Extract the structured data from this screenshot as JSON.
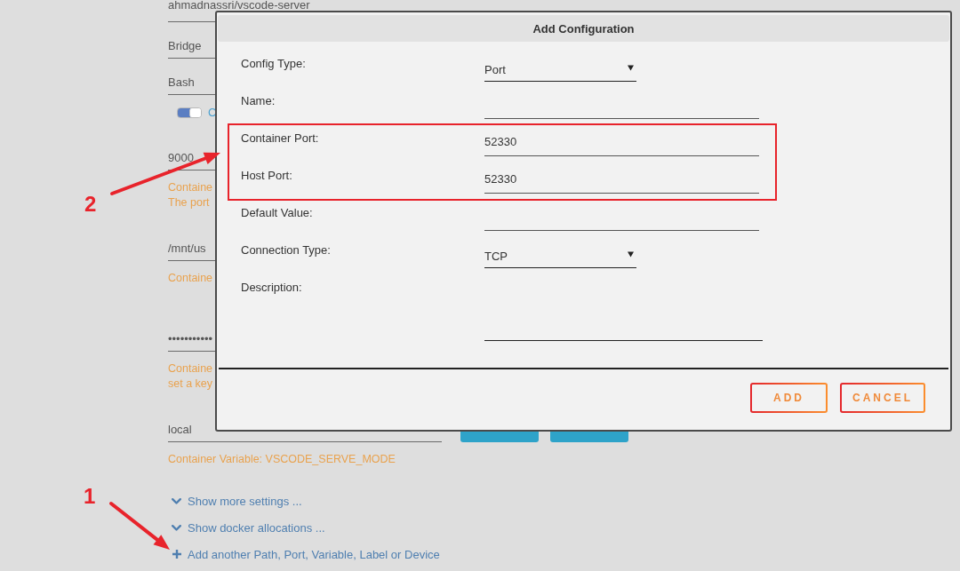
{
  "background_form": {
    "rows": [
      {
        "kind": "field",
        "value": "ahmadnassri/vscode-server"
      },
      {
        "kind": "field",
        "value": "Bridge"
      },
      {
        "kind": "field",
        "value": "Bash"
      },
      {
        "kind": "toggle",
        "on": true,
        "label": "C"
      },
      {
        "kind": "field",
        "value": "9000"
      },
      {
        "kind": "hint",
        "lines": [
          "Containe",
          "The port"
        ]
      },
      {
        "kind": "field",
        "value": "/mnt/us"
      },
      {
        "kind": "hint",
        "lines": [
          "Containe"
        ]
      },
      {
        "kind": "field",
        "value": "•••••••••••"
      },
      {
        "kind": "hint",
        "lines": [
          "Containe",
          "set a key"
        ]
      },
      {
        "kind": "field",
        "value": "local"
      },
      {
        "kind": "hint",
        "lines": [
          "Container Variable: VSCODE_SERVE_MODE"
        ]
      }
    ],
    "links": [
      {
        "kind": "expand",
        "label": "Show more settings ..."
      },
      {
        "kind": "expand",
        "label": "Show docker allocations ..."
      },
      {
        "kind": "add",
        "label": "Add another Path, Port, Variable, Label or Device"
      }
    ]
  },
  "dialog": {
    "title": "Add Configuration",
    "fields": [
      {
        "kind": "select",
        "label": "Config Type:",
        "value": "Port"
      },
      {
        "kind": "text",
        "label": "Name:"
      },
      {
        "kind": "text",
        "label": "Container Port:",
        "value": "52330"
      },
      {
        "kind": "text",
        "label": "Host Port:",
        "value": "52330"
      },
      {
        "kind": "text",
        "label": "Default Value:"
      },
      {
        "kind": "select",
        "label": "Connection Type:",
        "value": "TCP"
      },
      {
        "kind": "textarea",
        "label": "Description:"
      }
    ],
    "buttons": [
      "ADD",
      "CANCEL"
    ]
  },
  "annotations": [
    {
      "number": "2"
    },
    {
      "number": "1"
    }
  ]
}
